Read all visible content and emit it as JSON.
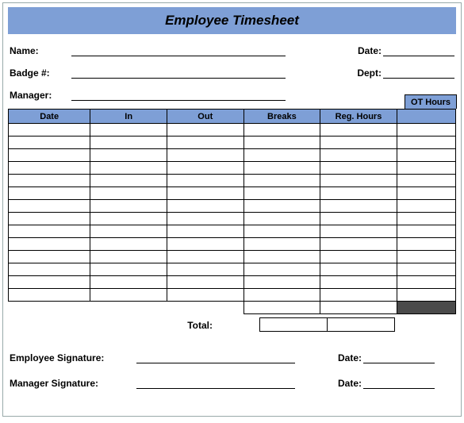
{
  "title": "Employee Timesheet",
  "fields": {
    "name_label": "Name:",
    "name_value": "",
    "badge_label": "Badge #:",
    "badge_value": "",
    "manager_label": "Manager:",
    "manager_value": "",
    "date_label": "Date:",
    "date_value": "",
    "dept_label": "Dept:",
    "dept_value": ""
  },
  "table": {
    "headers": {
      "date": "Date",
      "in": "In",
      "out": "Out",
      "breaks": "Breaks",
      "reg_hours": "Reg. Hours",
      "ot_hours": "OT Hours"
    },
    "rows": [
      {
        "date": "",
        "in": "",
        "out": "",
        "breaks": "",
        "reg": "",
        "ot": ""
      },
      {
        "date": "",
        "in": "",
        "out": "",
        "breaks": "",
        "reg": "",
        "ot": ""
      },
      {
        "date": "",
        "in": "",
        "out": "",
        "breaks": "",
        "reg": "",
        "ot": ""
      },
      {
        "date": "",
        "in": "",
        "out": "",
        "breaks": "",
        "reg": "",
        "ot": ""
      },
      {
        "date": "",
        "in": "",
        "out": "",
        "breaks": "",
        "reg": "",
        "ot": ""
      },
      {
        "date": "",
        "in": "",
        "out": "",
        "breaks": "",
        "reg": "",
        "ot": ""
      },
      {
        "date": "",
        "in": "",
        "out": "",
        "breaks": "",
        "reg": "",
        "ot": ""
      },
      {
        "date": "",
        "in": "",
        "out": "",
        "breaks": "",
        "reg": "",
        "ot": ""
      },
      {
        "date": "",
        "in": "",
        "out": "",
        "breaks": "",
        "reg": "",
        "ot": ""
      },
      {
        "date": "",
        "in": "",
        "out": "",
        "breaks": "",
        "reg": "",
        "ot": ""
      },
      {
        "date": "",
        "in": "",
        "out": "",
        "breaks": "",
        "reg": "",
        "ot": ""
      },
      {
        "date": "",
        "in": "",
        "out": "",
        "breaks": "",
        "reg": "",
        "ot": ""
      },
      {
        "date": "",
        "in": "",
        "out": "",
        "breaks": "",
        "reg": "",
        "ot": ""
      },
      {
        "date": "",
        "in": "",
        "out": "",
        "breaks": "",
        "reg": "",
        "ot": ""
      }
    ],
    "total_label": "Total:",
    "totals": {
      "breaks": "",
      "reg": "",
      "ot": ""
    }
  },
  "signatures": {
    "employee_label": "Employee Signature:",
    "employee_value": "",
    "manager_label": "Manager Signature:",
    "manager_value": "",
    "date_label": "Date:",
    "employee_date": "",
    "manager_date": ""
  }
}
